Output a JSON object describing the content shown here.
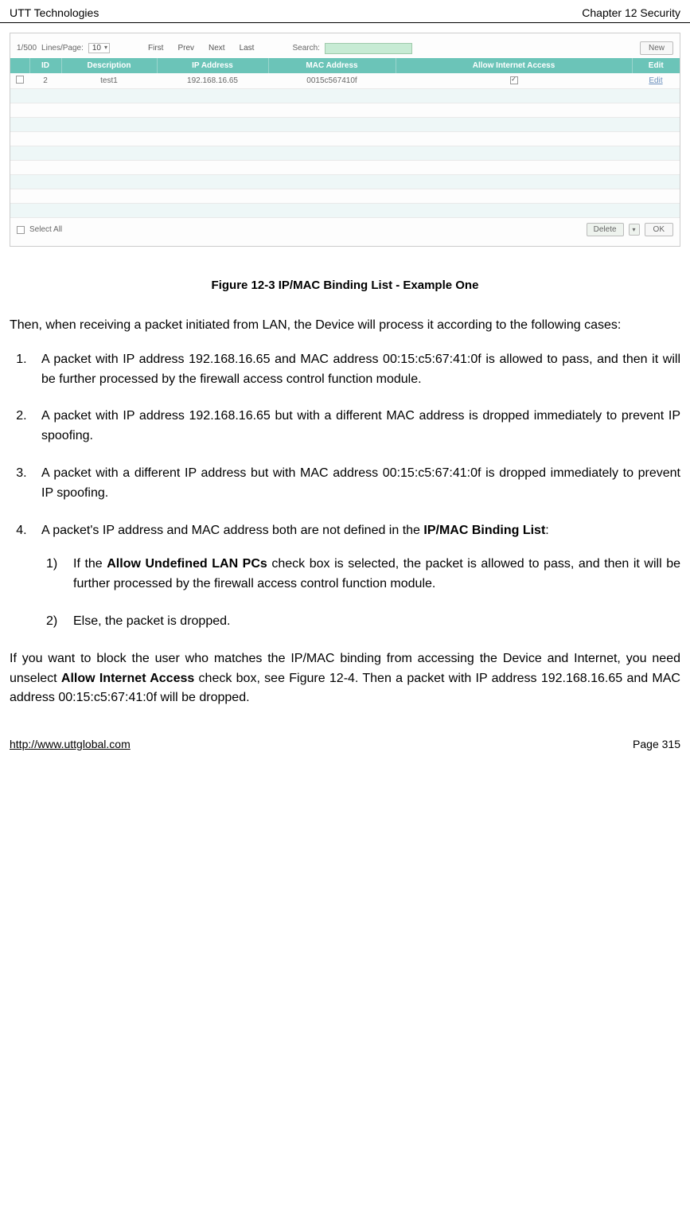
{
  "header": {
    "left": "UTT Technologies",
    "right": "Chapter 12 Security"
  },
  "screenshot": {
    "counter": "1/500",
    "lines_label": "Lines/Page:",
    "lines_value": "10",
    "nav": {
      "first": "First",
      "prev": "Prev",
      "next": "Next",
      "last": "Last"
    },
    "search_label": "Search:",
    "new_btn": "New",
    "columns": [
      "ID",
      "Description",
      "IP Address",
      "MAC Address",
      "Allow Internet Access",
      "Edit"
    ],
    "row": {
      "id": "2",
      "description": "test1",
      "ip": "192.168.16.65",
      "mac": "0015c567410f",
      "allow_checked": true,
      "edit": "Edit"
    },
    "select_all": "Select All",
    "delete_btn": "Delete",
    "ok_btn": "OK"
  },
  "figure_caption": "Figure 12-3 IP/MAC Binding List - Example One",
  "intro": "Then, when receiving a packet initiated from LAN, the Device will process it according to the following cases:",
  "items": [
    "A packet with IP address 192.168.16.65 and MAC address 00:15:c5:67:41:0f is allowed to pass, and then it will be further processed by the firewall access control function module.",
    "A packet with IP address 192.168.16.65 but with a different MAC address is dropped immediately to prevent IP spoofing.",
    "A packet with a different IP address but with MAC address 00:15:c5:67:41:0f is dropped immediately to prevent IP spoofing."
  ],
  "item4_prefix": "A packet's IP address and MAC address both are not defined in the ",
  "item4_bold": "IP/MAC Binding List",
  "item4_suffix": ":",
  "sub1_prefix": "If the ",
  "sub1_bold": "Allow Undefined LAN PCs",
  "sub1_suffix": " check box is selected, the packet is allowed to pass, and then it will be further processed by the firewall access control function module.",
  "sub2": "Else, the packet is dropped.",
  "closing_a": "If you want to block the user who matches the IP/MAC binding from accessing the Device and Internet, you need unselect ",
  "closing_bold": "Allow Internet Access",
  "closing_b": " check box, see Figure 12-4. Then a packet with IP address 192.168.16.65 and MAC address 00:15:c5:67:41:0f will be dropped.",
  "footer": {
    "url": "http://www.uttglobal.com",
    "page": "Page 315"
  }
}
